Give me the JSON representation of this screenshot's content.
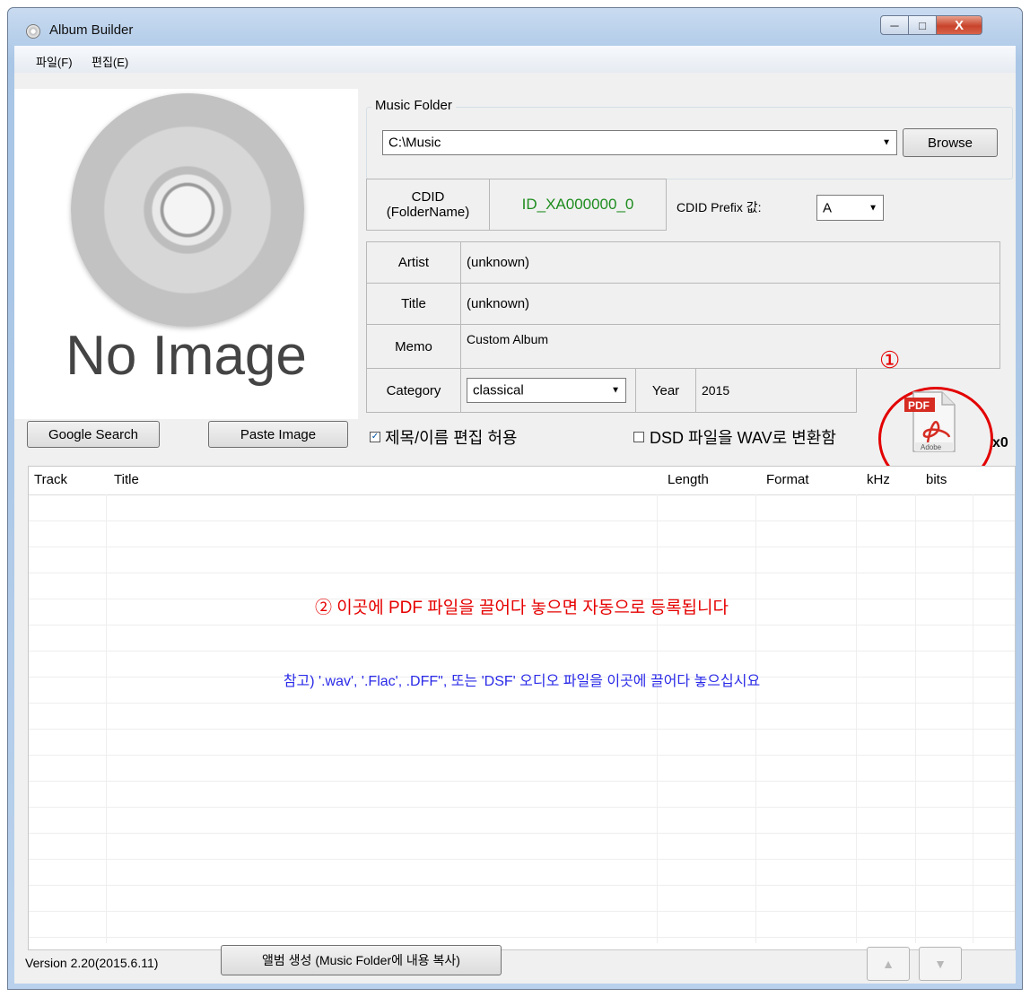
{
  "window": {
    "title": "Album Builder",
    "controls": {
      "min": "─",
      "max": "□",
      "close": "X"
    }
  },
  "menu": {
    "items": [
      "파일(F)",
      "편집(E)"
    ]
  },
  "cover": {
    "placeholder": "No Image"
  },
  "buttons": {
    "google_search": "Google Search",
    "paste_image": "Paste Image",
    "browse": "Browse",
    "create_album": "앨범 생성 (Music Folder에 내용 복사)"
  },
  "music_folder": {
    "label": "Music Folder",
    "path": "C:\\Music"
  },
  "cdid": {
    "label_line1": "CDID",
    "label_line2": "(FolderName)",
    "value": "ID_XA000000_0",
    "prefix_label": "CDID Prefix 값:",
    "prefix_value": "A"
  },
  "fields": {
    "artist_label": "Artist",
    "artist_value": "(unknown)",
    "title_label": "Title",
    "title_value": "(unknown)",
    "memo_label": "Memo",
    "memo_value": "Custom Album",
    "category_label": "Category",
    "category_value": "classical",
    "year_label": "Year",
    "year_value": "2015"
  },
  "checks": {
    "allow_edit_label": "제목/이름 편집 허용",
    "allow_edit_checked": true,
    "dsd_label": "DSD 파일을 WAV로 변환함",
    "dsd_checked": false
  },
  "pdf": {
    "callout_number": "①",
    "count": "x0",
    "icon_badge": "PDF",
    "icon_brand": "Adobe"
  },
  "table": {
    "columns": [
      "Track",
      "Title",
      "Length",
      "Format",
      "kHz",
      "bits"
    ],
    "drop_note": "② 이곳에 PDF 파일을 끌어다 놓으면 자동으로 등록됩니다",
    "audio_note": "참고) '.wav', '.Flac', .DFF\", 또는 'DSF' 오디오 파일을 이곳에 끌어다 놓으십시요"
  },
  "footer": {
    "version": "Version 2.20(2015.6.11)"
  },
  "colors": {
    "accent_red": "#e60000",
    "cdid_green": "#1e8c1e",
    "note_blue": "#2a2ae8"
  }
}
